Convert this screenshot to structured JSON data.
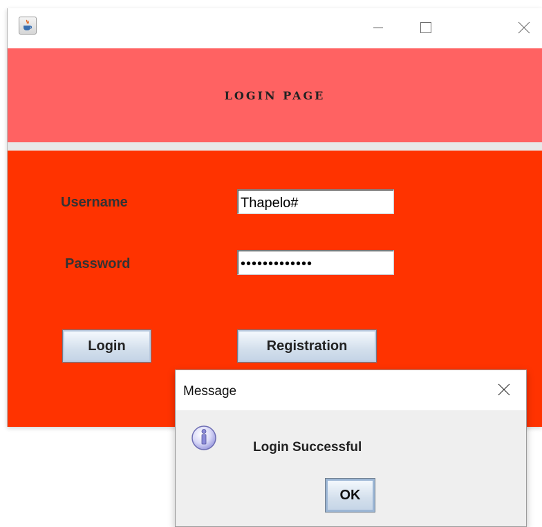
{
  "window": {
    "icon": "java-cup-icon",
    "controls": {
      "minimize": "minimize-icon",
      "maximize": "maximize-icon",
      "close": "close-icon"
    }
  },
  "header": {
    "title": "LOGIN PAGE",
    "background": "#ff6262"
  },
  "form": {
    "background": "#ff3300",
    "username_label": "Username",
    "username_value": "Thapelo#",
    "password_label": "Password",
    "password_value": "•••••••••••••",
    "login_button": "Login",
    "registration_button": "Registration"
  },
  "dialog": {
    "title": "Message",
    "icon": "info-icon",
    "message": "Login Successful",
    "ok_button": "OK"
  }
}
